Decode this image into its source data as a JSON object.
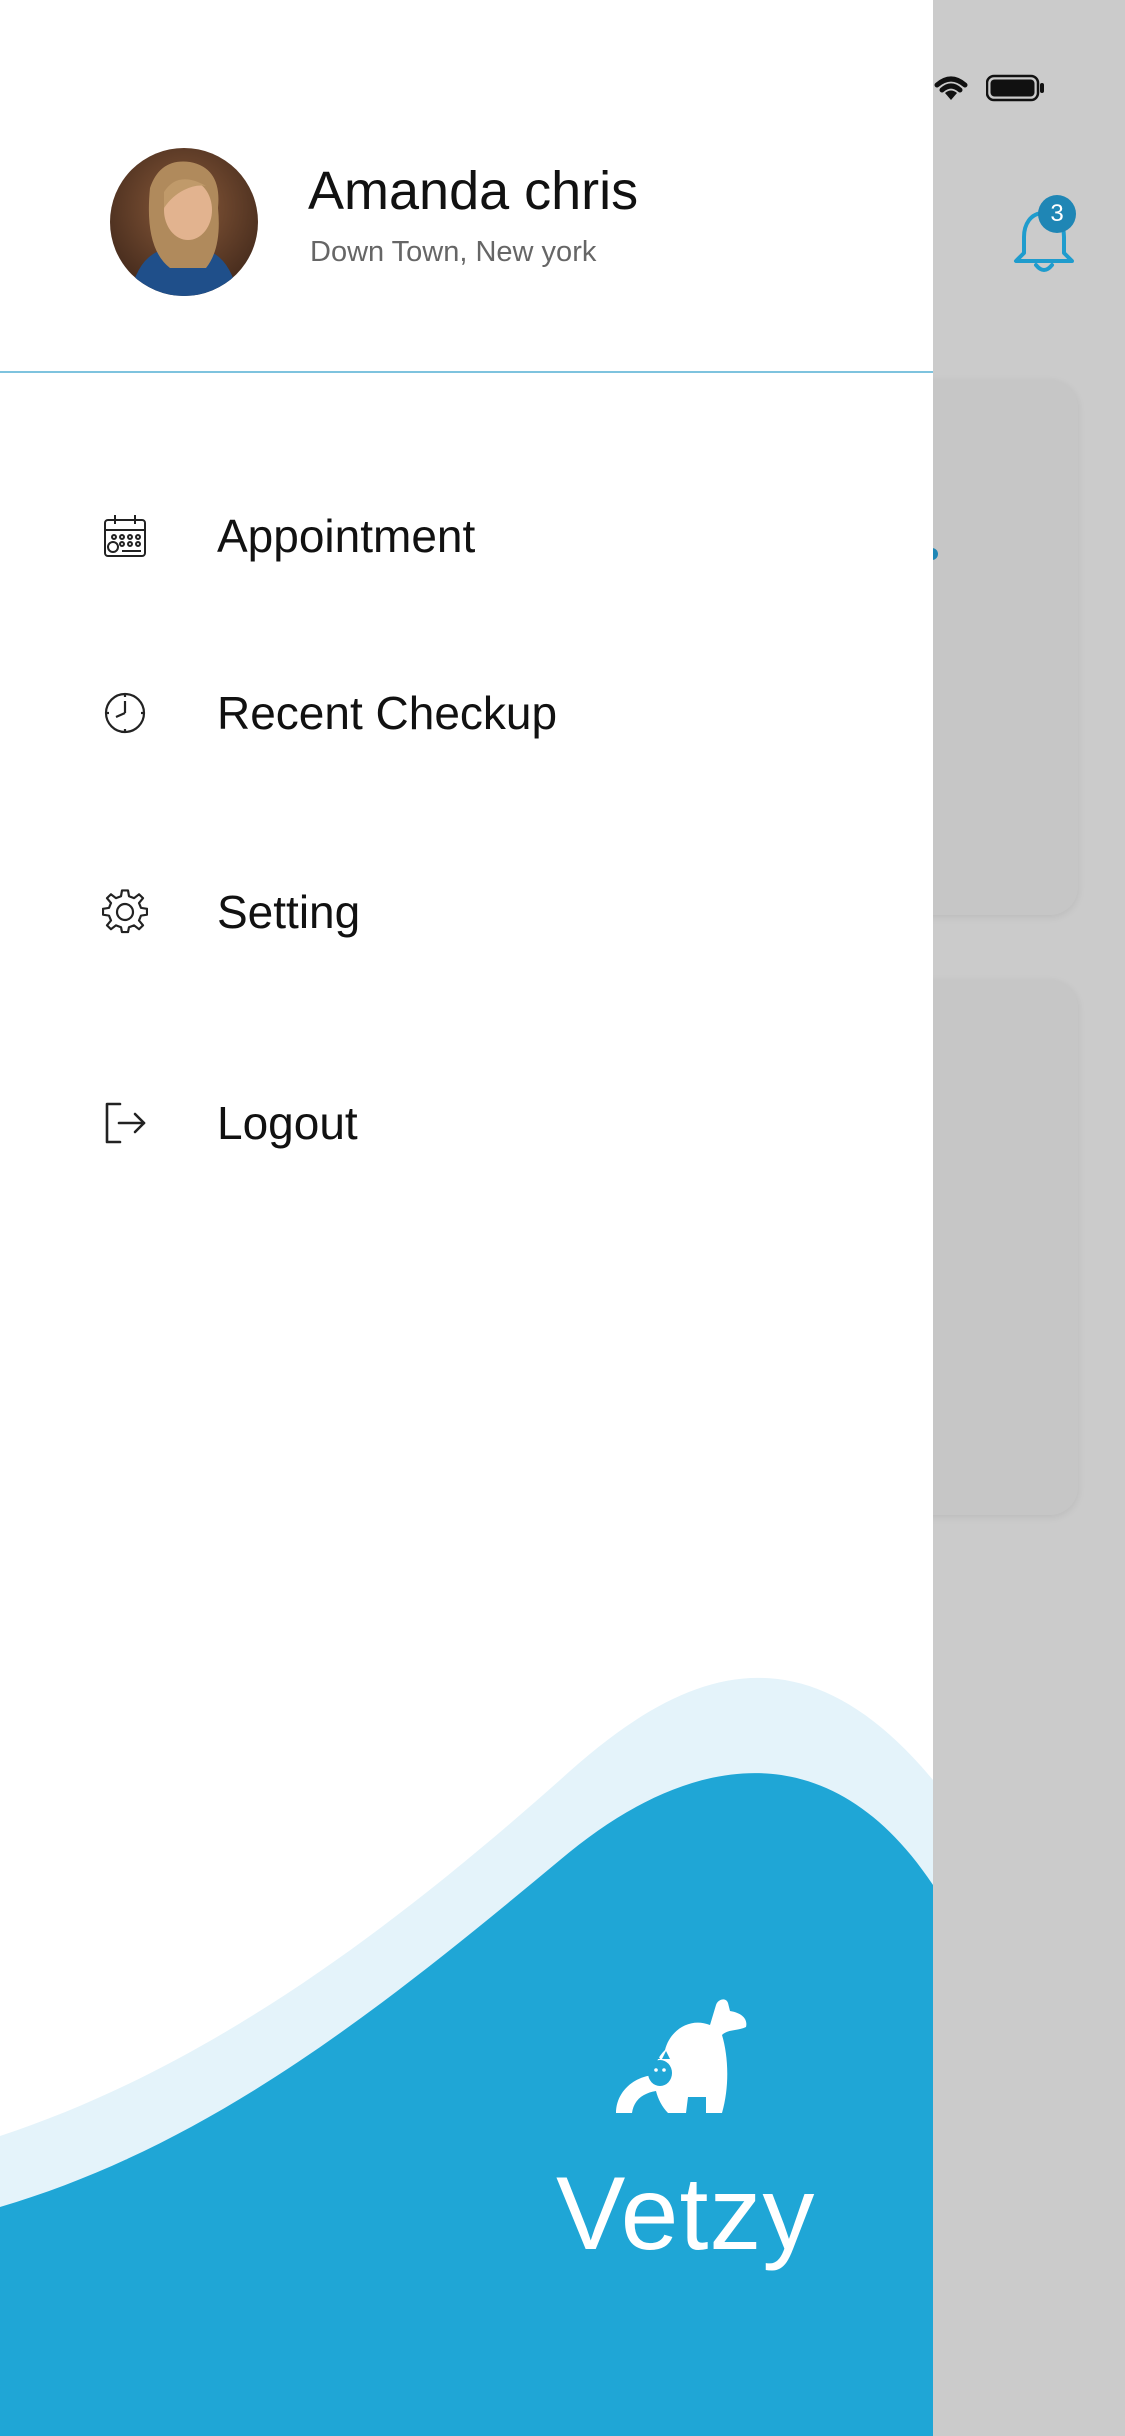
{
  "user": {
    "name": "Amanda chris",
    "location": "Down Town, New york"
  },
  "menu": {
    "items": [
      {
        "label": "Appointment",
        "icon": "calendar-icon"
      },
      {
        "label": "Recent Checkup",
        "icon": "clock-icon"
      },
      {
        "label": "Setting",
        "icon": "gear-icon"
      },
      {
        "label": "Logout",
        "icon": "logout-icon"
      }
    ]
  },
  "notifications": {
    "count": "3"
  },
  "brand": {
    "name": "Vetzy"
  },
  "colors": {
    "accent": "#1fa6d6",
    "accent_light": "#e4f3fa",
    "overlay": "#cbcbcb",
    "badge": "#1f86b5"
  }
}
